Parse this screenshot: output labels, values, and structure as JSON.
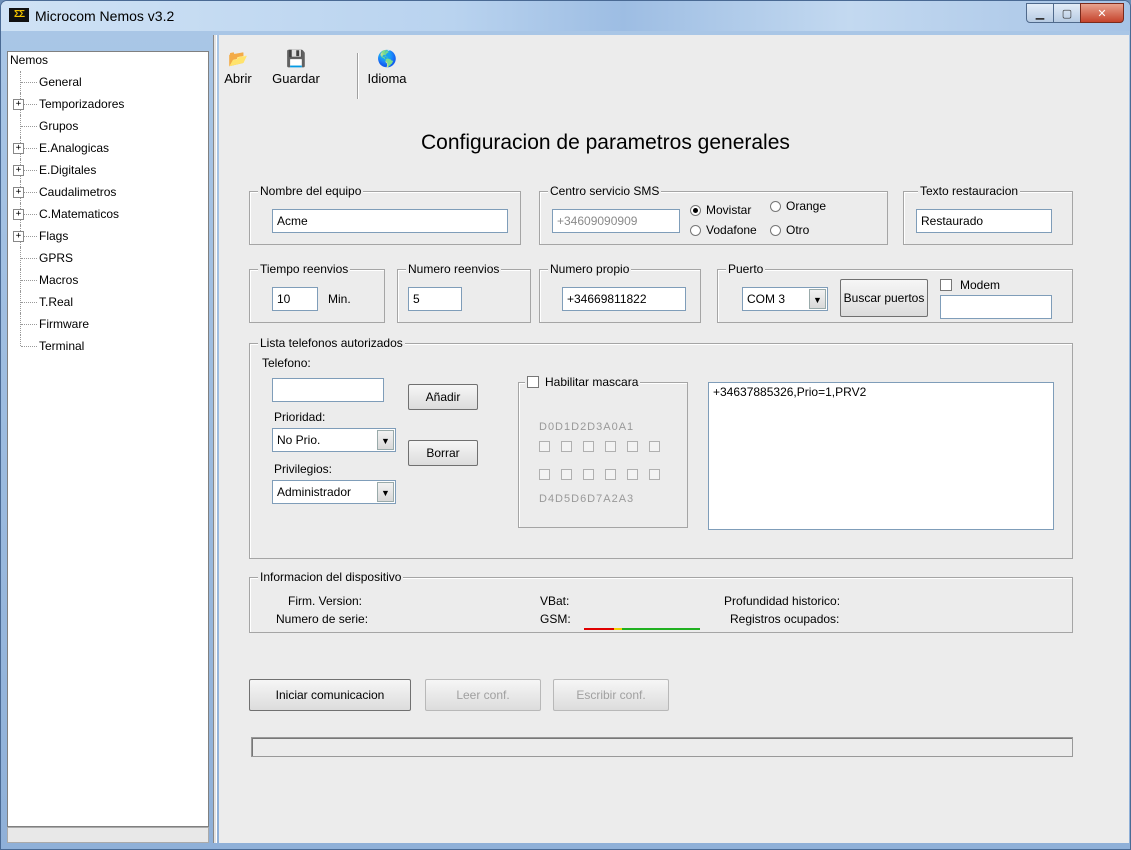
{
  "window": {
    "title": "Microcom Nemos v3.2",
    "icon_text": "ΣΣ"
  },
  "tree": {
    "root": "Nemos",
    "items": [
      {
        "label": "General",
        "expandable": false
      },
      {
        "label": "Temporizadores",
        "expandable": true
      },
      {
        "label": "Grupos",
        "expandable": false
      },
      {
        "label": "E.Analogicas",
        "expandable": true
      },
      {
        "label": "E.Digitales",
        "expandable": true
      },
      {
        "label": "Caudalimetros",
        "expandable": true
      },
      {
        "label": "C.Matematicos",
        "expandable": true
      },
      {
        "label": "Flags",
        "expandable": true
      },
      {
        "label": "GPRS",
        "expandable": false
      },
      {
        "label": "Macros",
        "expandable": false
      },
      {
        "label": "T.Real",
        "expandable": false
      },
      {
        "label": "Firmware",
        "expandable": false
      },
      {
        "label": "Terminal",
        "expandable": false
      }
    ]
  },
  "toolbar": {
    "open": "Abrir",
    "save": "Guardar",
    "language": "Idioma"
  },
  "heading": "Configuracion de parametros generales",
  "equipo": {
    "title": "Nombre del equipo",
    "value": "Acme"
  },
  "sms": {
    "title": "Centro servicio SMS",
    "value": "+34609090909",
    "options": {
      "movistar": "Movistar",
      "orange": "Orange",
      "vodafone": "Vodafone",
      "otro": "Otro"
    },
    "selected": "Movistar"
  },
  "restauracion": {
    "title": "Texto restauracion",
    "value": "Restaurado"
  },
  "reenvios": {
    "title": "Tiempo reenvios",
    "value": "10",
    "unit": "Min."
  },
  "num_reenvios": {
    "title": "Numero reenvios",
    "value": "5"
  },
  "propio": {
    "title": "Numero propio",
    "value": "+34669811822"
  },
  "puerto": {
    "title": "Puerto",
    "selected": "COM 3",
    "search_button": "Buscar puertos"
  },
  "modem": {
    "label": "Modem",
    "checked": false,
    "value": ""
  },
  "lista": {
    "title": "Lista telefonos autorizados",
    "telefono_label": "Telefono:",
    "telefono_value": "",
    "add_button": "Añadir",
    "delete_button": "Borrar",
    "prioridad_label": "Prioridad:",
    "prioridad_value": "No Prio.",
    "privilegios_label": "Privilegios:",
    "privilegios_value": "Administrador",
    "mask_title": "Habilitar mascara",
    "mask_enabled": false,
    "mask_top": "D0D1D2D3A0A1",
    "mask_bottom": "D4D5D6D7A2A3",
    "entries": [
      "+34637885326,Prio=1,PRV2"
    ]
  },
  "info": {
    "title": "Informacion del dispositivo",
    "firm_version": "Firm. Version:",
    "numero_serie": "Numero de serie:",
    "vbat": "VBat:",
    "gsm": "GSM:",
    "profundidad": "Profundidad historico:",
    "registros": "Registros ocupados:",
    "gsm_colors": [
      "#e00000",
      "#f0d000",
      "#20b020"
    ]
  },
  "actions": {
    "start": "Iniciar comunicacion",
    "read": "Leer conf.",
    "write": "Escribir conf."
  }
}
